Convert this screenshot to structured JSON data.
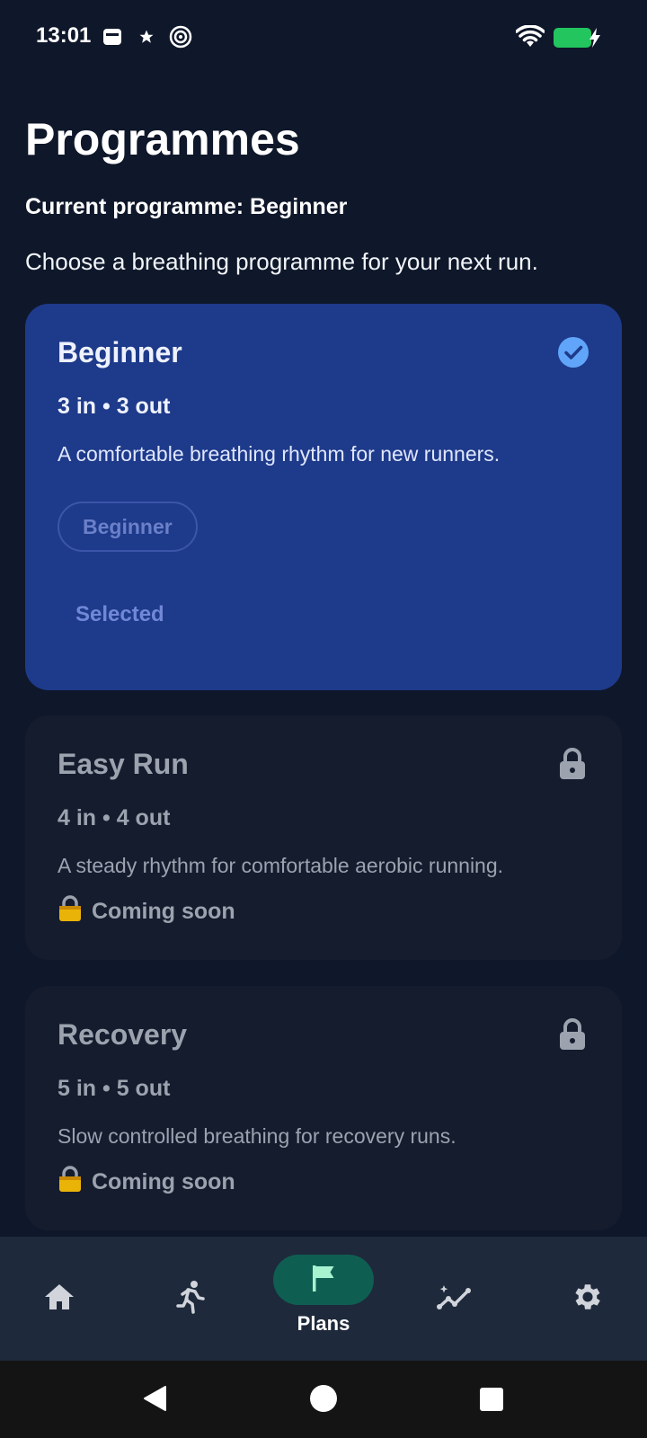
{
  "status_bar": {
    "time": "13:01",
    "icons": [
      "sim-card-icon",
      "star-icon",
      "nfc-icon",
      "wifi-icon",
      "battery-charging-icon"
    ],
    "battery_color": "#22c55e"
  },
  "header": {
    "title": "Programmes",
    "current_programme": "Current programme: Beginner",
    "subtitle": "Choose a breathing programme for your next run."
  },
  "programmes": [
    {
      "title": "Beginner",
      "rhythm": "3 in • 3 out",
      "description": "A comfortable breathing rhythm for new runners.",
      "level_chip": "Beginner",
      "action_label": "Selected",
      "state": "selected",
      "status_icon": "check-circle-icon"
    },
    {
      "title": "Easy Run",
      "rhythm": "4 in • 4 out",
      "description": "A steady rhythm for comfortable aerobic running.",
      "status_label": "Coming soon",
      "state": "locked",
      "status_icon": "lock-icon"
    },
    {
      "title": "Recovery",
      "rhythm": "5 in • 5 out",
      "description": "Slow controlled breathing for recovery runs.",
      "status_label": "Coming soon",
      "state": "locked",
      "status_icon": "lock-icon"
    }
  ],
  "bottom_nav": {
    "items": [
      {
        "icon": "home-icon",
        "label": ""
      },
      {
        "icon": "running-icon",
        "label": ""
      },
      {
        "icon": "flag-icon",
        "label": "Plans",
        "active": true
      },
      {
        "icon": "sparkline-icon",
        "label": ""
      },
      {
        "icon": "gear-icon",
        "label": ""
      }
    ]
  },
  "colors": {
    "background": "#0f172a",
    "selected_card": "#1e3a8a",
    "locked_card": "#141c2e",
    "accent_check": "#60a5fa",
    "active_nav_pill": "#0f5e52"
  }
}
